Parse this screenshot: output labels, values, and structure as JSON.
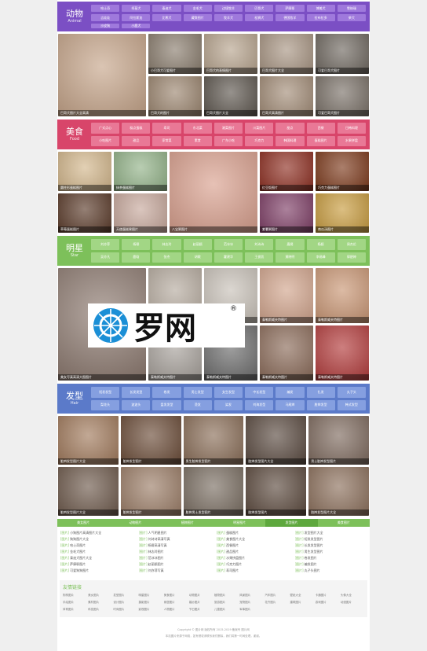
{
  "sections": [
    {
      "key": "animal",
      "title": "动物",
      "sub": "Animal",
      "tags": [
        "哈士奇",
        "柯基犬",
        "泰迪犬",
        "金毛犬",
        "边境牧羊",
        "巴哥犬",
        "萨摩耶",
        "博美犬",
        "雪纳瑞",
        "吉娃娃",
        "阿拉斯加",
        "比熊犬",
        "藏獒图片",
        "牧羊犬",
        "松狮犬",
        "德国牧羊",
        "拉布拉多",
        "柴犬",
        "沙皮狗",
        "小鹿犬"
      ],
      "images": [
        "巴哥犬图片大全高清",
        "小巴哥犬可爱图片",
        "巴哥犬的表情图片",
        "巴哥犬图片大全",
        "可爱巴哥犬图片",
        "巴哥犬的图片",
        "巴哥犬图片大全",
        "巴哥犬高清图片",
        "可爱巴哥犬图片"
      ],
      "colors": [
        "#c6a58a",
        "#8a7d6e",
        "#b7a48e",
        "#a89583",
        "#6f6860",
        "#9c8670",
        "#5e574f",
        "#a38d78",
        "#7a7168"
      ]
    },
    {
      "key": "food",
      "title": "美食",
      "sub": "Food",
      "tags": [
        "广式点心",
        "糕点蛋糕",
        "寿司",
        "东北菜",
        "湘菜图片",
        "川菜图片",
        "甜点",
        "西餐",
        "日韩料理",
        "小吃图片",
        "甜品",
        "家常菜",
        "素食",
        "广东小吃",
        "巧克力",
        "韩国料理",
        "蛋糕图片",
        "水果拼盘"
      ],
      "images": [
        "圆柱形蛋糕图片",
        "抹茶蛋糕图片",
        "八宝粥图片",
        "红豆饭图片",
        "巧克力蛋糕图片",
        "草莓蛋糕图片",
        "天使蛋糕果图片",
        "紫薯粥图片",
        "南瓜汤图片"
      ],
      "colors": [
        "#d3b78c",
        "#93b389",
        "#d9a08e",
        "#8e2f22",
        "#7d3a1c",
        "#5b3b2a",
        "#c7a89c",
        "#7e3e66",
        "#c89c3f"
      ]
    },
    {
      "key": "star",
      "title": "明星",
      "sub": "Star",
      "tags": [
        "刘亦菲",
        "杨幂",
        "林志玲",
        "赵丽颖",
        "范冰冰",
        "刘诗诗",
        "唐嫣",
        "杨颖",
        "周杰伦",
        "吴亦凡",
        "鹿晗",
        "张杰",
        "胡歌",
        "霍建华",
        "王俊凯",
        "黄晓明",
        "李易峰",
        "郭碧婷"
      ],
      "images": [
        "美女写真高清大图图片",
        "泰勒斯威夫特图片",
        "泰勒斯威夫特写真",
        "泰勒斯威夫特图片",
        "泰勒斯威夫特图片",
        "泰勒斯威夫特图片",
        "泰勒斯威夫特图片",
        "泰勒斯威夫特图片",
        "泰勒斯威夫特图片"
      ],
      "colors": [
        "#8d7a70",
        "#b5aa9e",
        "#c8c1b8",
        "#d1a48c",
        "#c99674",
        "#a6a09a",
        "#6b6b6b",
        "#8a6a58",
        "#b23a3a"
      ]
    },
    {
      "key": "hair",
      "title": "发型",
      "sub": "Hair",
      "tags": [
        "短发发型",
        "长发发型",
        "卷发",
        "男士发型",
        "女生发型",
        "中长发型",
        "编发",
        "扎发",
        "丸子头",
        "梨花头",
        "波波头",
        "盘发发型",
        "烫发",
        "染发",
        "刘海发型",
        "马尾辫",
        "脏辫发型",
        "韩式发型"
      ],
      "images": [
        "脏辫发型图片大全",
        "脏辫发型图片",
        "男生脏辫发型图片",
        "脏辫发型图片大全",
        "男士脏辫发型图片",
        "脏辫发型图片大全",
        "脏辫发型图片",
        "脏辫男士发型图片",
        "脏辫发型图片"
      ],
      "colors": [
        "#a17a5c",
        "#6b4c38",
        "#8a6e58",
        "#5a4a40",
        "#7e6a5e",
        "#6e5a4c",
        "#9c7e68",
        "#7a6e62",
        "#5c4a3e",
        "#8c705c"
      ]
    }
  ],
  "link_tabs": [
    "美女图片",
    "动物图片",
    "植物图片",
    "明星图片",
    "发型图片",
    "美食图片"
  ],
  "link_columns": [
    [
      "小狗图片高清图片大全",
      "狗狗图片大全",
      "哈士奇图片",
      "金毛犬图片",
      "泰迪犬图片大全",
      "萨摩耶图片",
      "可爱狗狗图片"
    ],
    [
      "人气明星图片",
      "刘诗诗高清写真",
      "杨幂高清写真",
      "林志玲图片",
      "范冰冰图片",
      "赵丽颖图片",
      "刘亦菲写真"
    ],
    [
      "蛋糕图片",
      "美食图片大全",
      "西餐图片",
      "甜品图片",
      "水果拼盘图片",
      "巧克力图片",
      "寿司图片"
    ],
    [
      "发型图片大全",
      "短发发型图片",
      "长发发型图片",
      "男生发型图片",
      "卷发图片",
      "编发图片",
      "丸子头图片"
    ]
  ],
  "link_tag": "[图片]",
  "friends": {
    "title": "友情链接",
    "items": [
      "狗狗图片",
      "美女图片",
      "发型图片",
      "明星图片",
      "美食图片",
      "动物图片",
      "植物图片",
      "风景图片",
      "汽车图片",
      "壁纸大全",
      "卡通图片",
      "头像大全",
      "手绘图片",
      "素材图片",
      "设计图片",
      "摄影图片",
      "家居图片",
      "婚纱图片",
      "旅游图片",
      "宠物图片",
      "花卉图片",
      "建筑图片",
      "游戏图片",
      "动漫图片",
      "体育图片",
      "科技图片",
      "时尚图片",
      "影视图片",
      "人物图片",
      "节日图片",
      "儿童图片",
      "军事图片"
    ]
  },
  "footer": {
    "line1": "Copyright © 图片网 版权所有 2015-2019 备案号 图片网",
    "line2": "本站图片来源于网络，如有侵权请联系我们删除，我们将第一时间处理，谢谢。"
  },
  "watermark": {
    "text": "罗网",
    "reg": "®"
  }
}
